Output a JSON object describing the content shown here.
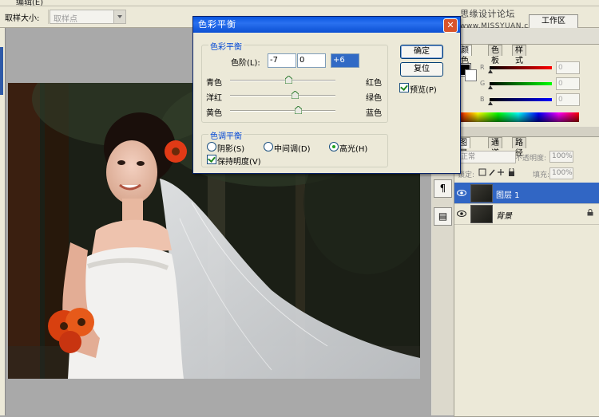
{
  "toolbar": {
    "sample_label": "取样大小:",
    "sample_value": "取样点",
    "workspace": "工作区"
  },
  "watermark": {
    "text": "思缘设计论坛",
    "url": "www.MISSYUAN.com"
  },
  "dialog": {
    "title": "色彩平衡",
    "balance_group": "色彩平衡",
    "levels_label": "色阶(L):",
    "levels": [
      "-7",
      "0",
      "+6"
    ],
    "sliders": [
      {
        "left": "青色",
        "right": "红色",
        "value": -7
      },
      {
        "left": "洋红",
        "right": "绿色",
        "value": 0
      },
      {
        "left": "黄色",
        "right": "蓝色",
        "value": 6
      }
    ],
    "tone_group": "色调平衡",
    "tones": [
      "阴影(S)",
      "中间调(D)",
      "高光(H)"
    ],
    "selected_tone": "高光(H)",
    "preserve_luminosity": "保持明度(V)",
    "ok": "确定",
    "reset": "复位",
    "preview": "预览(P)"
  },
  "color_panel": {
    "tabs": [
      "颜色",
      "色板",
      "样式"
    ],
    "channels": [
      {
        "label": "R",
        "value": "0"
      },
      {
        "label": "G",
        "value": "0"
      },
      {
        "label": "B",
        "value": "0"
      }
    ]
  },
  "layers_panel": {
    "tabs": [
      "图层",
      "通道",
      "路径"
    ],
    "blend_mode": "正常",
    "opacity_label": "不透明度:",
    "opacity": "100%",
    "lock_label": "锁定:",
    "fill_label": "填充:",
    "fill": "100%",
    "layers": [
      {
        "name": "图层 1",
        "selected": true
      },
      {
        "name": "背景",
        "selected": false
      }
    ]
  },
  "colors": {
    "title_bar": "#0a56e0",
    "selected_layer": "#3166c4",
    "group_title": "#0046d5"
  }
}
